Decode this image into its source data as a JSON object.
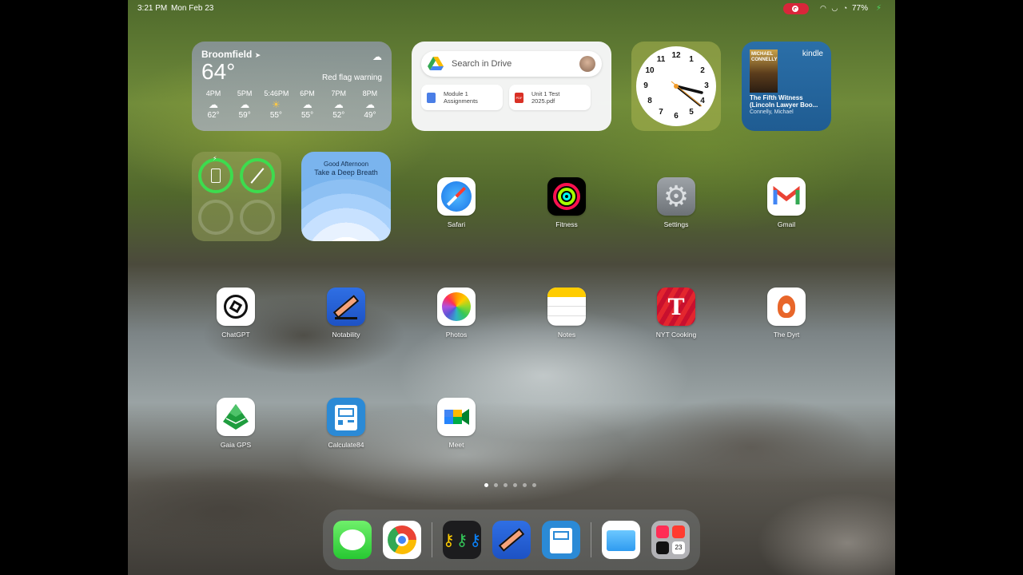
{
  "status_bar": {
    "time": "3:21 PM",
    "date": "Mon Feb 23",
    "battery": "77%"
  },
  "widgets": {
    "weather": {
      "city": "Broomfield",
      "temperature": "64°",
      "alert": "Red flag warning",
      "hourly": [
        {
          "time": "4PM",
          "icon": "cloud-icon",
          "temp": "62°"
        },
        {
          "time": "5PM",
          "icon": "cloud-icon",
          "temp": "59°"
        },
        {
          "time": "5:46PM",
          "icon": "sunset-icon",
          "temp": "55°"
        },
        {
          "time": "6PM",
          "icon": "cloud-icon",
          "temp": "55°"
        },
        {
          "time": "7PM",
          "icon": "cloud-icon",
          "temp": "52°"
        },
        {
          "time": "8PM",
          "icon": "cloud-icon",
          "temp": "49°"
        }
      ]
    },
    "drive": {
      "search_placeholder": "Search in Drive",
      "files": [
        {
          "name": "Module 1 Assignments",
          "line1": "Module 1",
          "line2": "Assignments",
          "type": "doc"
        },
        {
          "name": "Unit 1 Test 2025.pdf",
          "line1": "Unit 1 Test",
          "line2": "2025.pdf",
          "type": "pdf"
        }
      ]
    },
    "clock": {
      "numbers": [
        "12",
        "1",
        "2",
        "3",
        "4",
        "5",
        "6",
        "7",
        "8",
        "9",
        "10",
        "11"
      ]
    },
    "kindle": {
      "brand": "kindle",
      "cover_text": "MICHAEL CONNELLY",
      "book_title": "The Fifth Witness (Lincoln Lawyer Boo...",
      "author": "Connelly, Michael"
    },
    "breathe": {
      "greeting": "Good Afternoon",
      "prompt": "Take a Deep Breath"
    }
  },
  "apps": [
    {
      "name": "Safari",
      "icon": "safari-icon"
    },
    {
      "name": "Fitness",
      "icon": "fitness-icon"
    },
    {
      "name": "Settings",
      "icon": "settings-icon"
    },
    {
      "name": "Gmail",
      "icon": "gmail-icon"
    },
    {
      "name": "ChatGPT",
      "icon": "chatgpt-icon"
    },
    {
      "name": "Notability",
      "icon": "notability-icon"
    },
    {
      "name": "Photos",
      "icon": "photos-icon"
    },
    {
      "name": "Notes",
      "icon": "notes-icon"
    },
    {
      "name": "NYT Cooking",
      "icon": "nyt-cooking-icon"
    },
    {
      "name": "The Dyrt",
      "icon": "dyrt-icon"
    },
    {
      "name": "Gaia GPS",
      "icon": "gaia-gps-icon"
    },
    {
      "name": "Calculate84",
      "icon": "calculate84-icon"
    },
    {
      "name": "Meet",
      "icon": "meet-icon"
    }
  ],
  "dock": [
    {
      "icon": "messages-icon"
    },
    {
      "icon": "chrome-icon"
    },
    {
      "icon": "passwords-icon"
    },
    {
      "icon": "notability-icon"
    },
    {
      "icon": "calculate84-icon"
    },
    {
      "icon": "files-icon"
    },
    {
      "icon": "app-library-icon"
    }
  ],
  "page_indicator": {
    "pages": 6,
    "current": 1
  },
  "colors": {
    "ring_green": "#3ddc4e",
    "record_red": "#d9263a",
    "kindle_blue": "#1f5c92"
  }
}
